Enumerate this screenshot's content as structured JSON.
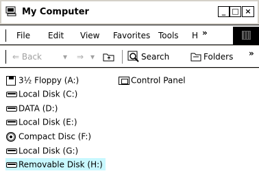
{
  "window": {
    "title": "My Computer",
    "min_glyph": "_",
    "max_glyph": "□",
    "close_glyph": "×"
  },
  "menu": {
    "items": [
      "File",
      "Edit",
      "View",
      "Favorites",
      "Tools",
      "H"
    ],
    "overflow": "»"
  },
  "toolbar": {
    "back": "⇐ Back",
    "back_arrow": "▾",
    "forward": "⇒",
    "forward_arrow": "▾",
    "search": "Search",
    "folders": "Folders",
    "overflow": "»"
  },
  "items": {
    "floppy": "3½ Floppy (A:)",
    "control_panel": "Control Panel",
    "c": "Local Disk (C:)",
    "d": "DATA (D:)",
    "e": "Local Disk (E:)",
    "f": "Compact Disc (F:)",
    "g": "Local Disk (G:)",
    "h": "Removable Disk (H:)"
  },
  "colors": {
    "selection": "#c8f8ff"
  }
}
